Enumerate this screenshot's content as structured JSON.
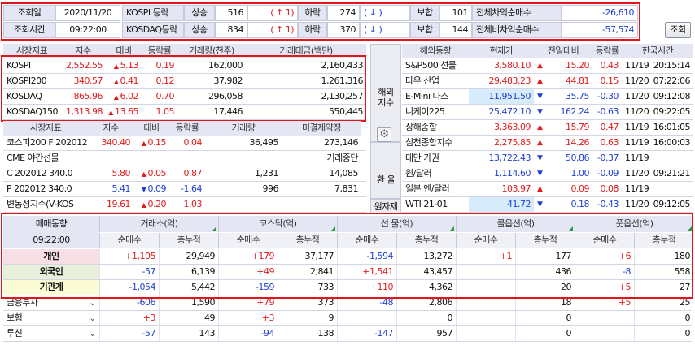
{
  "top": {
    "date_label": "조회일",
    "date_value": "2020/11/20",
    "time_label": "조회시간",
    "time_value": "09:22:00",
    "rows": [
      {
        "name": "KOSPI 등락",
        "up_label": "상승",
        "up_value": "516",
        "limit_up": "( ↑   1)",
        "down_label": "하락",
        "down_value": "274",
        "limit_down": "( ↓      )",
        "flat_label": "보합",
        "flat_value": "101",
        "net_label": "전체차익순매수",
        "net_value": "-26,610"
      },
      {
        "name": "KOSDAQ등락",
        "up_label": "상승",
        "up_value": "834",
        "limit_up": "( ↑   1)",
        "down_label": "하락",
        "down_value": "370",
        "limit_down": "( ↓      )",
        "flat_label": "보합",
        "flat_value": "144",
        "net_label": "전체비차익순매수",
        "net_value": "-57,574"
      }
    ],
    "search_button": "조회"
  },
  "index_table": {
    "headers": [
      "시장지표",
      "지수",
      "대비",
      "등락률",
      "거래량(천주)",
      "거래대금(백만)"
    ],
    "rows": [
      {
        "name": "KOSPI",
        "price": "2,552.55",
        "arrow": "▲",
        "change": "5.13",
        "rate": "0.19",
        "volume": "162,000",
        "amount": "2,160,433"
      },
      {
        "name": "KOSPI200",
        "price": "340.57",
        "arrow": "▲",
        "change": "0.41",
        "rate": "0.12",
        "volume": "37,982",
        "amount": "1,261,316"
      },
      {
        "name": "KOSDAQ",
        "price": "865.96",
        "arrow": "▲",
        "change": "6.02",
        "rate": "0.70",
        "volume": "296,058",
        "amount": "2,130,257"
      },
      {
        "name": "KOSDAQ150",
        "price": "1,313.98",
        "arrow": "▲",
        "change": "13.65",
        "rate": "1.05",
        "volume": "17,446",
        "amount": "550,445"
      }
    ]
  },
  "futures_table": {
    "headers": [
      "시장지표",
      "지수",
      "대비",
      "등락률",
      "거래량",
      "미결제약정"
    ],
    "rows": [
      {
        "name": "코스피200 F 202012",
        "price": "340.40",
        "arrow": "▲",
        "change": "0.15",
        "rate": "0.04",
        "volume": "36,495",
        "oi": "273,146",
        "color": "red"
      },
      {
        "name": "CME 야간선물",
        "price": "",
        "arrow": "",
        "change": "",
        "rate": "",
        "volume": "",
        "oi": "거래중단",
        "color": "black"
      },
      {
        "name": "C 202012 340.0",
        "price": "5.80",
        "arrow": "▲",
        "change": "0.05",
        "rate": "0.87",
        "volume": "1,231",
        "oi": "14,085",
        "color": "red"
      },
      {
        "name": "P 202012 340.0",
        "price": "5.41",
        "arrow": "▼",
        "change": "0.09",
        "rate": "-1.64",
        "volume": "996",
        "oi": "7,831",
        "color": "blue"
      },
      {
        "name": "변동성지수(V-KOS",
        "price": "19.61",
        "arrow": "▲",
        "change": "0.20",
        "rate": "1.03",
        "volume": "",
        "oi": "",
        "color": "red"
      }
    ]
  },
  "side_labels": {
    "overseas": "해외\n지수",
    "gear": "gear-icon",
    "fx": "환 율",
    "raw": "원자재"
  },
  "world_table": {
    "headers": [
      "해외동향",
      "현재가",
      "전일대비",
      "등락률",
      "한국시간"
    ],
    "rows": [
      {
        "name": "S&P500 선물",
        "price": "3,580.10",
        "arrow": "▲",
        "change": "15.20",
        "rate": "0.43",
        "date": "11/19",
        "time": "20:15:14",
        "color": "red",
        "hl": false
      },
      {
        "name": "다우 산업",
        "price": "29,483.23",
        "arrow": "▲",
        "change": "44.81",
        "rate": "0.15",
        "date": "11/20",
        "time": "07:22:06",
        "color": "red",
        "hl": false
      },
      {
        "name": "E-Mini 나스",
        "price": "11,951.50",
        "arrow": "▼",
        "change": "35.75",
        "rate": "-0.30",
        "date": "11/20",
        "time": "09:12:08",
        "color": "blue",
        "hl": true
      },
      {
        "name": "니케이225",
        "price": "25,472.10",
        "arrow": "▼",
        "change": "162.24",
        "rate": "-0.63",
        "date": "11/20",
        "time": "09:22:05",
        "color": "blue",
        "hl": false
      },
      {
        "name": "상해종합",
        "price": "3,363.09",
        "arrow": "▲",
        "change": "15.79",
        "rate": "0.47",
        "date": "11/19",
        "time": "16:01:05",
        "color": "red",
        "hl": false
      },
      {
        "name": "심천종합지수",
        "price": "2,275.85",
        "arrow": "▲",
        "change": "14.26",
        "rate": "0.63",
        "date": "11/19",
        "time": "16:00:03",
        "color": "red",
        "hl": false
      },
      {
        "name": "대만 가권",
        "price": "13,722.43",
        "arrow": "▼",
        "change": "50.86",
        "rate": "-0.37",
        "date": "11/19",
        "time": "",
        "color": "blue",
        "hl": false
      },
      {
        "name": "원/달러",
        "price": "1,114.60",
        "arrow": "▼",
        "change": "1.00",
        "rate": "-0.09",
        "date": "11/20",
        "time": "09:21:21",
        "color": "blue",
        "hl": false
      },
      {
        "name": "일본 엔/달러",
        "price": "103.97",
        "arrow": "▲",
        "change": "0.09",
        "rate": "0.08",
        "date": "11/19",
        "time": "",
        "color": "red",
        "hl": false
      },
      {
        "name": "WTI 21-01",
        "price": "41.72",
        "arrow": "▼",
        "change": "0.18",
        "rate": "-0.43",
        "date": "11/20",
        "time": "09:12:05",
        "color": "blue",
        "hl": true
      }
    ]
  },
  "investor": {
    "title": "매매동향",
    "time": "09:22:00",
    "groups": [
      "거래소(억)",
      "코스닥(억)",
      "선  물(억)",
      "콜옵션(억)",
      "풋옵션(억)"
    ],
    "sub": [
      "순매수",
      "총누적"
    ],
    "rows": [
      {
        "name": "개인",
        "bg": "#f8dfe6",
        "vals": [
          {
            "v": "+1,105",
            "c": "red"
          },
          {
            "v": "29,949",
            "c": "black"
          },
          {
            "v": "+179",
            "c": "red"
          },
          {
            "v": "37,177",
            "c": "black"
          },
          {
            "v": "-1,594",
            "c": "blue"
          },
          {
            "v": "13,272",
            "c": "black"
          },
          {
            "v": "+1",
            "c": "red"
          },
          {
            "v": "177",
            "c": "black"
          },
          {
            "v": "+6",
            "c": "red"
          },
          {
            "v": "180",
            "c": "black"
          }
        ]
      },
      {
        "name": "외국인",
        "bg": "#e8efda",
        "vals": [
          {
            "v": "-57",
            "c": "blue"
          },
          {
            "v": "6,139",
            "c": "black"
          },
          {
            "v": "+49",
            "c": "red"
          },
          {
            "v": "2,841",
            "c": "black"
          },
          {
            "v": "+1,541",
            "c": "red"
          },
          {
            "v": "43,457",
            "c": "black"
          },
          {
            "v": "",
            "c": "black"
          },
          {
            "v": "436",
            "c": "black"
          },
          {
            "v": "-8",
            "c": "blue"
          },
          {
            "v": "558",
            "c": "black"
          }
        ]
      },
      {
        "name": "기관계",
        "bg": "#fbfbd5",
        "vals": [
          {
            "v": "-1,054",
            "c": "blue"
          },
          {
            "v": "5,442",
            "c": "black"
          },
          {
            "v": "-159",
            "c": "blue"
          },
          {
            "v": "733",
            "c": "black"
          },
          {
            "v": "+110",
            "c": "red"
          },
          {
            "v": "4,362",
            "c": "black"
          },
          {
            "v": "",
            "c": "black"
          },
          {
            "v": "20",
            "c": "black"
          },
          {
            "v": "+5",
            "c": "red"
          },
          {
            "v": "27",
            "c": "black"
          }
        ]
      },
      {
        "name": "금융투자",
        "bg": "#ffffff",
        "vals": [
          {
            "v": "-606",
            "c": "blue"
          },
          {
            "v": "1,590",
            "c": "black"
          },
          {
            "v": "+79",
            "c": "red"
          },
          {
            "v": "373",
            "c": "black"
          },
          {
            "v": "-48",
            "c": "blue"
          },
          {
            "v": "2,806",
            "c": "black"
          },
          {
            "v": "",
            "c": "black"
          },
          {
            "v": "18",
            "c": "black"
          },
          {
            "v": "+5",
            "c": "red"
          },
          {
            "v": "25",
            "c": "black"
          }
        ]
      },
      {
        "name": "보험",
        "bg": "#ffffff",
        "vals": [
          {
            "v": "+3",
            "c": "red"
          },
          {
            "v": "49",
            "c": "black"
          },
          {
            "v": "+3",
            "c": "red"
          },
          {
            "v": "9",
            "c": "black"
          },
          {
            "v": "",
            "c": "black"
          },
          {
            "v": "0",
            "c": "black"
          },
          {
            "v": "",
            "c": "black"
          },
          {
            "v": "0",
            "c": "black"
          },
          {
            "v": "",
            "c": "black"
          },
          {
            "v": "0",
            "c": "black"
          }
        ]
      },
      {
        "name": "투신",
        "bg": "#ffffff",
        "vals": [
          {
            "v": "-57",
            "c": "blue"
          },
          {
            "v": "143",
            "c": "black"
          },
          {
            "v": "-94",
            "c": "blue"
          },
          {
            "v": "138",
            "c": "black"
          },
          {
            "v": "-147",
            "c": "blue"
          },
          {
            "v": "957",
            "c": "black"
          },
          {
            "v": "",
            "c": "black"
          },
          {
            "v": "0",
            "c": "black"
          },
          {
            "v": "",
            "c": "black"
          },
          {
            "v": "0",
            "c": "black"
          }
        ]
      }
    ]
  }
}
